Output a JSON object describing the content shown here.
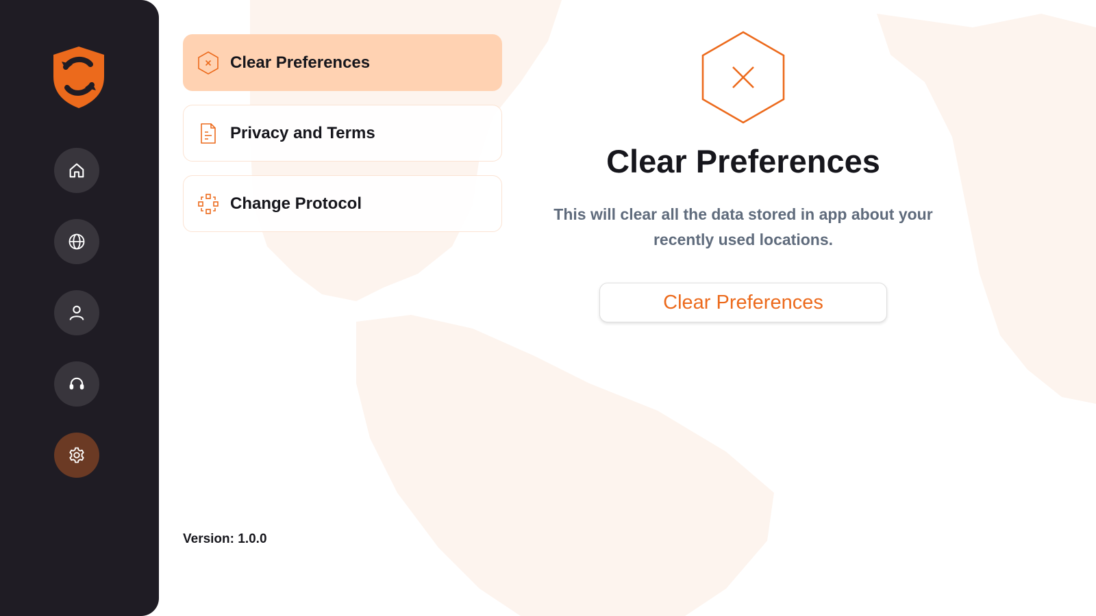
{
  "brand": {
    "accent": "#ec6a1c",
    "sidebar_bg": "#1f1c24",
    "active_item_bg": "#ffd2b2"
  },
  "sidebar": {
    "logo": "shield-refresh-logo",
    "items": [
      {
        "icon": "home-icon",
        "active": false
      },
      {
        "icon": "globe-icon",
        "active": false
      },
      {
        "icon": "user-icon",
        "active": false
      },
      {
        "icon": "headset-icon",
        "active": false
      },
      {
        "icon": "gear-icon",
        "active": true
      }
    ]
  },
  "menu": {
    "items": [
      {
        "label": "Clear Preferences",
        "icon": "hexagon-x-icon",
        "active": true
      },
      {
        "label": "Privacy and Terms",
        "icon": "document-icon",
        "active": false
      },
      {
        "label": "Change Protocol",
        "icon": "protocol-icon",
        "active": false
      }
    ]
  },
  "detail": {
    "icon": "hexagon-x-icon",
    "title": "Clear Preferences",
    "description": "This will clear all the data stored in app about your recently used locations.",
    "button_label": "Clear Preferences"
  },
  "footer": {
    "version": "Version: 1.0.0"
  }
}
